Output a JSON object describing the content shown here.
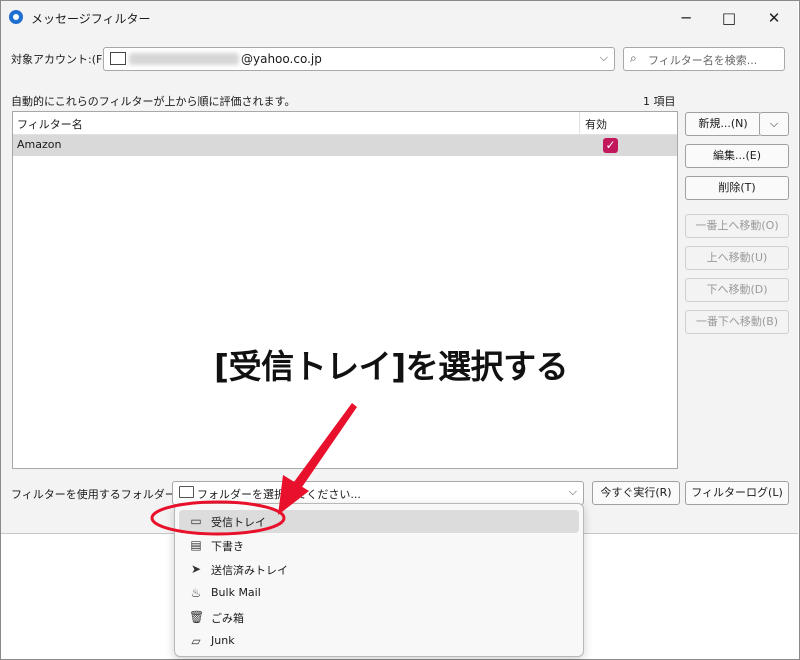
{
  "window": {
    "title": "メッセージフィルター",
    "minimize_glyph": "─",
    "maximize_glyph": "□",
    "close_glyph": "✕"
  },
  "account": {
    "label": "対象アカウント:(F)",
    "value": "@yahoo.co.jp",
    "chevron": "⌵"
  },
  "search": {
    "placeholder": "フィルター名を検索...",
    "icon": "search-icon"
  },
  "list": {
    "description": "自動的にこれらのフィルターが上から順に評価されます。",
    "count": "1 項目",
    "columns": [
      "フィルター名",
      "有効"
    ],
    "rows": [
      {
        "name": "Amazon",
        "enabled": true
      }
    ]
  },
  "buttons": {
    "new": "新規...(N)",
    "new_arrow": "⌵",
    "edit": "編集...(E)",
    "delete": "削除(T)",
    "move_top": "一番上へ移動(O)",
    "move_up": "上へ移動(U)",
    "move_down": "下へ移動(D)",
    "move_bottom": "一番下へ移動(B)",
    "run_now": "今すぐ実行(R)",
    "filter_log": "フィルターログ(L)"
  },
  "folder": {
    "label": "フィルターを使用するフォルダー:(C)",
    "placeholder": "フォルダーを選択してください...",
    "chevron": "⌵",
    "options": [
      {
        "label": "受信トレイ",
        "icon": "inbox-icon",
        "glyph": "▭"
      },
      {
        "label": "下書き",
        "icon": "draft-icon",
        "glyph": "▤"
      },
      {
        "label": "送信済みトレイ",
        "icon": "send-icon",
        "glyph": "➤"
      },
      {
        "label": "Bulk Mail",
        "icon": "spam-icon",
        "glyph": "♨"
      },
      {
        "label": "ごみ箱",
        "icon": "trash-icon",
        "glyph": "🗑"
      },
      {
        "label": "Junk",
        "icon": "folder-icon",
        "glyph": "▱"
      }
    ],
    "selected_index": 0
  },
  "annotation": {
    "text": "[受信トレイ]を選択する",
    "color": "#e8102a"
  }
}
